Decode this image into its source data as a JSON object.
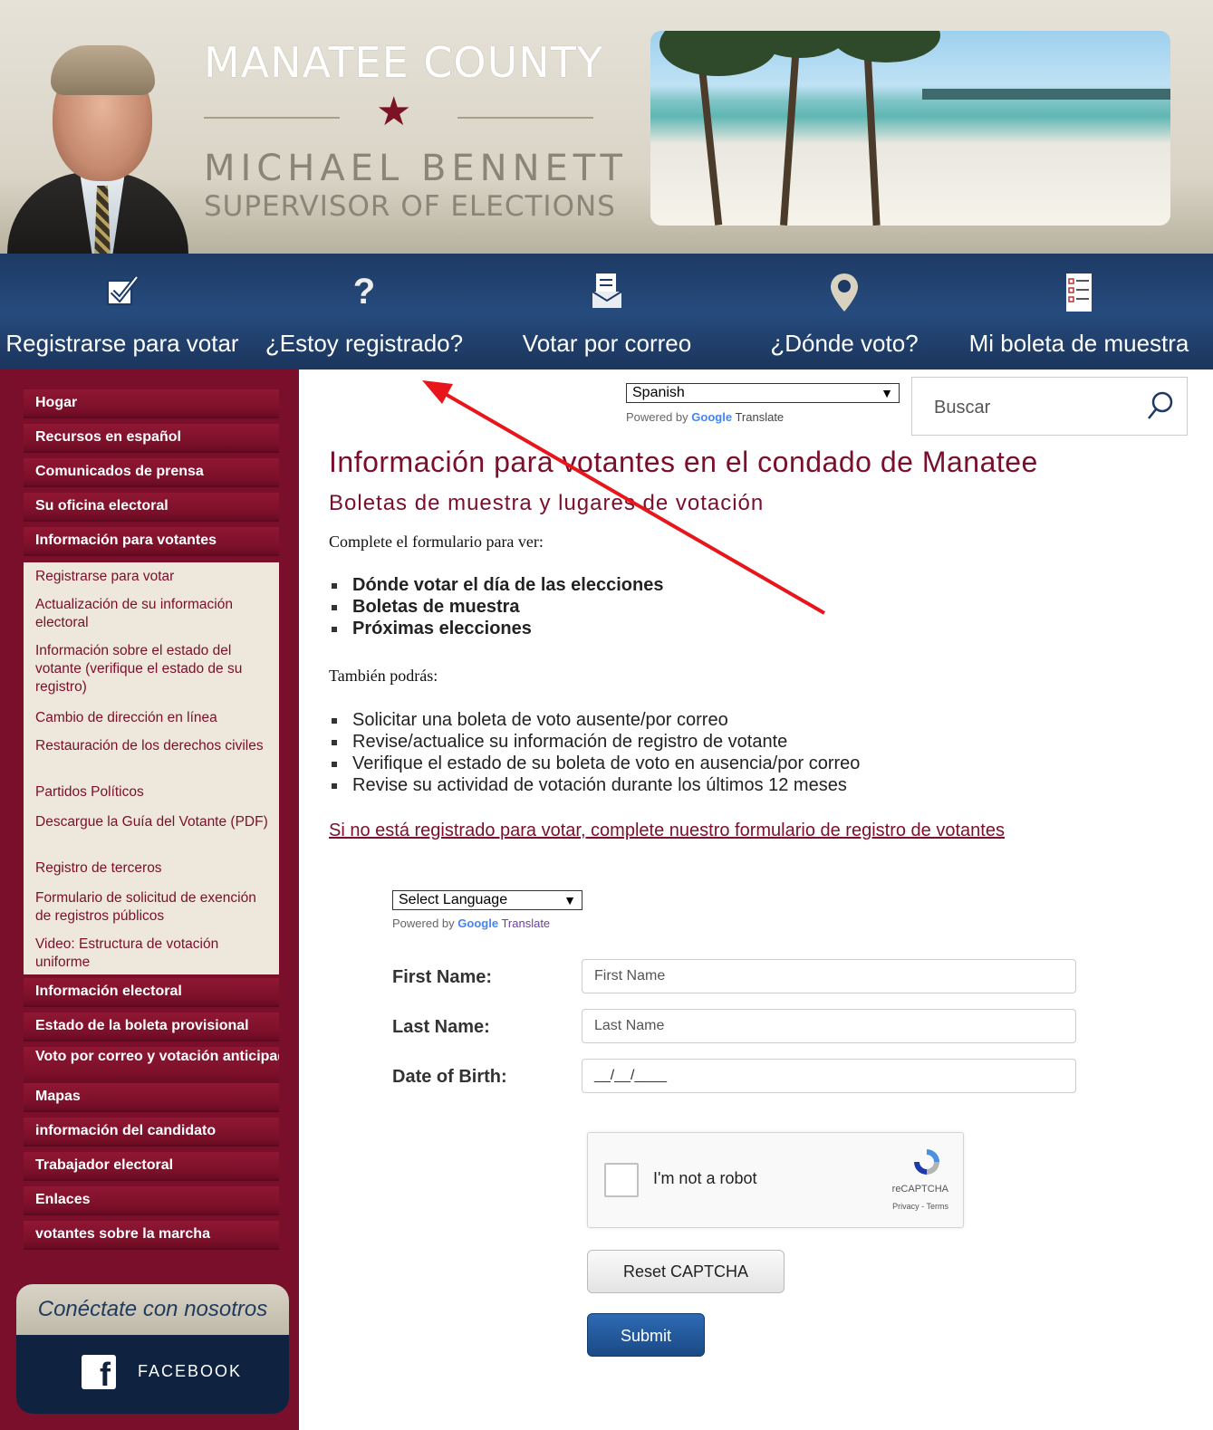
{
  "header": {
    "county": "MANATEE COUNTY",
    "name": "MICHAEL BENNETT",
    "role": "SUPERVISOR OF ELECTIONS"
  },
  "nav": [
    {
      "label": "Registrarse para votar",
      "icon": "checkbox-icon"
    },
    {
      "label": "¿Estoy registrado?",
      "icon": "question-icon"
    },
    {
      "label": "Votar por correo",
      "icon": "mail-ballot-icon"
    },
    {
      "label": "¿Dónde voto?",
      "icon": "location-pin-icon"
    },
    {
      "label": "Mi boleta de muestra",
      "icon": "checklist-icon"
    }
  ],
  "sidebar": {
    "items": [
      "Hogar",
      "Recursos en español",
      "Comunicados de prensa",
      "Su oficina electoral",
      "Información para votantes"
    ],
    "submenu": [
      "Registrarse para votar",
      "Actualización de su información electoral",
      "Información sobre el estado del votante (verifique el estado de su registro)",
      "Cambio de dirección en línea",
      "Restauración de los derechos civiles",
      "Partidos Políticos",
      "Descargue la Guía del Votante (PDF)",
      "Registro de terceros",
      "Formulario de solicitud de exención de registros públicos",
      "Video: Estructura de votación uniforme"
    ],
    "items2": [
      "Información electoral",
      "Estado de la boleta provisional",
      "Voto por correo y votación anticipada",
      "Mapas",
      "información del candidato",
      "Trabajador electoral",
      "Enlaces",
      "votantes sobre la marcha"
    ],
    "connect_title": "Conéctate con nosotros",
    "facebook": "FACEBOOK"
  },
  "translate": {
    "language": "Spanish",
    "powered_by": "Powered by",
    "google": "Google",
    "translate": "Translate",
    "select_language": "Select Language"
  },
  "search": {
    "placeholder": "Buscar"
  },
  "main": {
    "title": "Información para votantes en el condado de Manatee",
    "subtitle": "Boletas de muestra y lugares de votación",
    "intro": "Complete el formulario para ver:",
    "list1": [
      "Dónde votar el día de las elecciones",
      "Boletas de muestra",
      "Próximas elecciones"
    ],
    "also": "También podrás:",
    "list2": [
      "Solicitar una boleta de voto ausente/por correo",
      "Revise/actualice su información de registro de votante",
      "Verifique el estado de su boleta de voto en ausencia/por correo",
      "Revise su actividad de votación durante los últimos 12 meses"
    ],
    "register_link": "Si no está registrado para votar, complete nuestro formulario de registro de votantes"
  },
  "form": {
    "first_label": "First Name:",
    "first_placeholder": "First Name",
    "last_label": "Last Name:",
    "last_placeholder": "Last Name",
    "dob_label": "Date of Birth:",
    "dob_value": "__/__/____",
    "captcha_text": "I'm not a robot",
    "captcha_brand": "reCAPTCHA",
    "captcha_links": "Privacy - Terms",
    "reset": "Reset CAPTCHA",
    "submit": "Submit"
  },
  "colors": {
    "maroon": "#7a0f2b",
    "navy": "#1d3a64",
    "annotation_arrow": "#e8151b"
  }
}
